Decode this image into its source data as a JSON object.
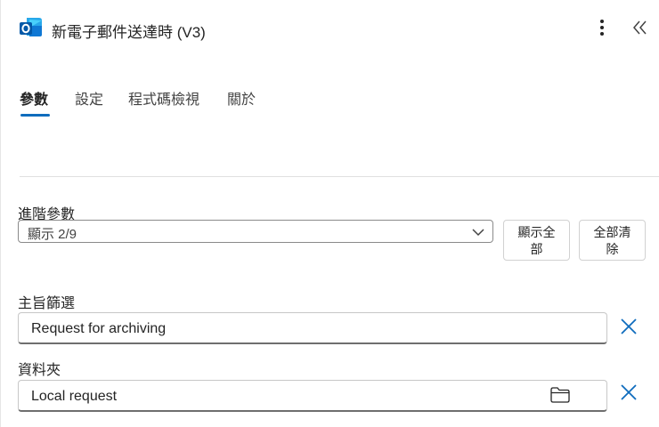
{
  "header": {
    "title": "新電子郵件送達時 (V3)",
    "icons": {
      "app": "outlook-icon",
      "more": "more-vertical-icon",
      "collapse": "double-chevron-left-icon"
    }
  },
  "tabs": [
    {
      "label": "參數",
      "active": true
    },
    {
      "label": "設定",
      "active": false
    },
    {
      "label": "程式碼檢視",
      "active": false
    },
    {
      "label": "關於",
      "active": false
    }
  ],
  "advanced": {
    "label": "進階參數",
    "selected": "顯示 2/9",
    "show_all_line1": "顯示全",
    "show_all_line2": "部",
    "clear_all_line1": "全部清",
    "clear_all_line2": "除"
  },
  "fields": {
    "subject_filter": {
      "label": "主旨篩選",
      "value": "Request for archiving"
    },
    "folder": {
      "label": "資料夾",
      "value": "Local request"
    }
  },
  "colors": {
    "accent": "#0f6cbd",
    "outlook_blue": "#0f78d4"
  }
}
